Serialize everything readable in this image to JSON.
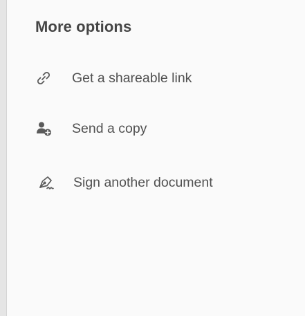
{
  "panel": {
    "title": "More options"
  },
  "options": [
    {
      "label": "Get a shareable link",
      "icon": "link-icon"
    },
    {
      "label": "Send a copy",
      "icon": "add-person-icon"
    },
    {
      "label": "Sign another document",
      "icon": "pen-sign-icon"
    }
  ],
  "colors": {
    "background": "#fafafa",
    "rail": "#e5e5e5",
    "title_text": "#454545",
    "label_text": "#505050",
    "icon": "#5a5a5a"
  }
}
